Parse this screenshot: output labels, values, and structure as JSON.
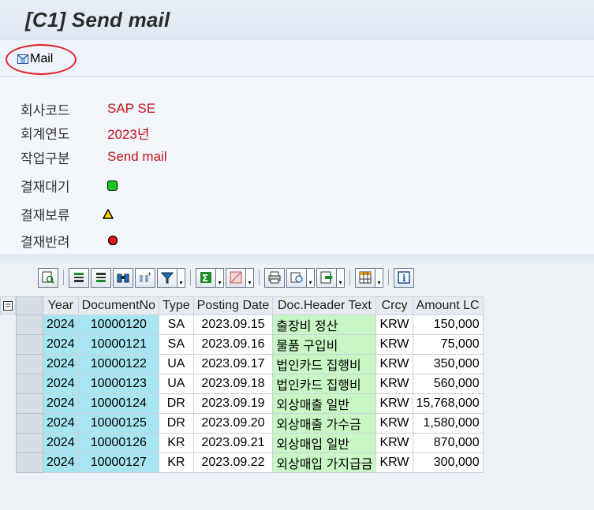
{
  "window": {
    "title": "[C1] Send mail"
  },
  "toolbar": {
    "mail_label": "Mail"
  },
  "header_info": {
    "company_label": "회사코드",
    "company_value": "SAP SE",
    "year_label": "회계연도",
    "year_value": "2023년",
    "task_label": "작업구분",
    "task_value": "Send mail",
    "legend": [
      {
        "label": "결재대기",
        "icon": "green-square-icon"
      },
      {
        "label": "결재보류",
        "icon": "yellow-triangle-icon"
      },
      {
        "label": "결재반려",
        "icon": "red-circle-icon"
      }
    ]
  },
  "alv": {
    "columns": [
      "Year",
      "DocumentNo",
      "Type",
      "Posting Date",
      "Doc.Header Text",
      "Crcy",
      "Amount LC"
    ],
    "rows": [
      [
        "2024",
        "10000120",
        "SA",
        "2023.09.15",
        "출장비 정산",
        "KRW",
        "150,000"
      ],
      [
        "2024",
        "10000121",
        "SA",
        "2023.09.16",
        "물품 구입비",
        "KRW",
        "75,000"
      ],
      [
        "2024",
        "10000122",
        "UA",
        "2023.09.17",
        "법인카드 집행비",
        "KRW",
        "350,000"
      ],
      [
        "2024",
        "10000123",
        "UA",
        "2023.09.18",
        "법인카드 집행비",
        "KRW",
        "560,000"
      ],
      [
        "2024",
        "10000124",
        "DR",
        "2023.09.19",
        "외상매출 일반",
        "KRW",
        "15,768,000"
      ],
      [
        "2024",
        "10000125",
        "DR",
        "2023.09.20",
        "외상매출 가수금",
        "KRW",
        "1,580,000"
      ],
      [
        "2024",
        "10000126",
        "KR",
        "2023.09.21",
        "외상매입 일반",
        "KRW",
        "870,000"
      ],
      [
        "2024",
        "10000127",
        "KR",
        "2023.09.22",
        "외상매입 가지급금",
        "KRW",
        "300,000"
      ]
    ]
  },
  "colors": {
    "title_text": "#2b2b2b",
    "value_red": "#c0141b",
    "highlight_circle": "#e2232a",
    "key_cell_bg": "#a7e6f1",
    "text_cell_bg": "#c8f7c5"
  }
}
